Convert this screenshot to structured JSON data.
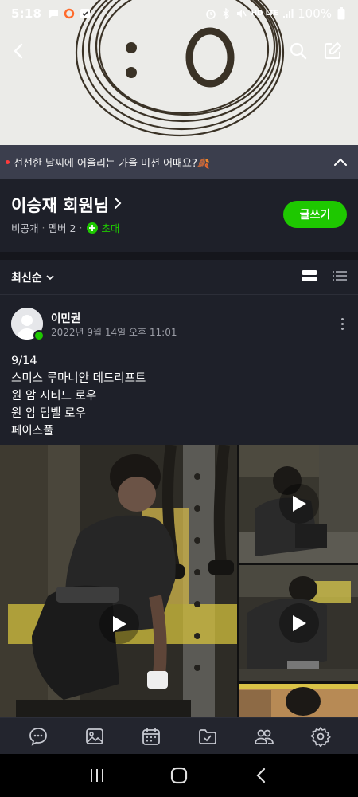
{
  "status_bar": {
    "time": "5:18",
    "battery": "100%",
    "network": "HD LTE"
  },
  "notice": {
    "text": "선선한 날씨에 어울리는 가을 미션 어때요?🍂"
  },
  "band": {
    "title": "이승재 회원님",
    "privacy": "비공개",
    "members": "멤버 2",
    "invite": "초대",
    "write_button": "글쓰기"
  },
  "sort": {
    "label": "최신순"
  },
  "post": {
    "author": "이민권",
    "date": "2022년 9월 14일 오후 11:01",
    "lines": [
      "9/14",
      "스미스 루마니안 데드리프트",
      "원 암 시티드 로우",
      "원 암 덤벨 로우",
      "페이스풀"
    ]
  },
  "icons": {
    "back": "back-arrow-icon",
    "search": "search-icon",
    "edit": "edit-icon",
    "tabs": [
      "chat-icon",
      "photo-icon",
      "calendar-icon",
      "folder-icon",
      "members-icon",
      "settings-icon"
    ],
    "system": [
      "recents-icon",
      "home-icon",
      "back-icon"
    ]
  },
  "colors": {
    "accent": "#1ec800",
    "background": "#1e2029",
    "notice_bg": "#3b3e4d"
  }
}
